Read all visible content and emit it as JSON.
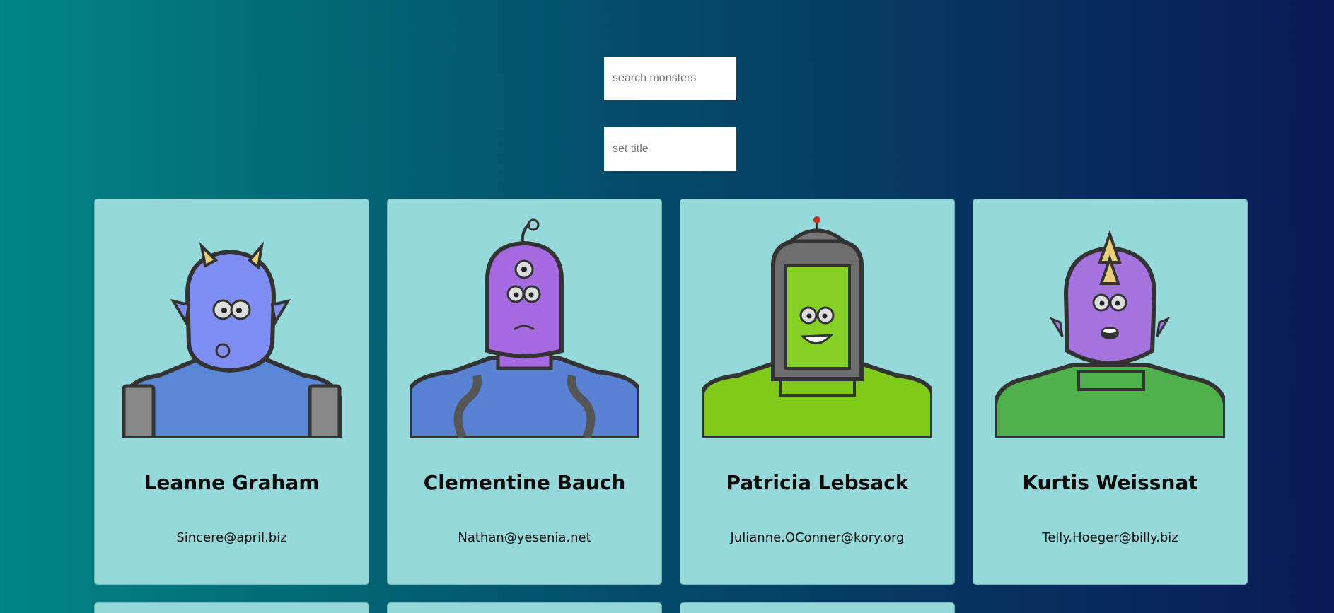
{
  "search": {
    "placeholder": "search monsters",
    "value": ""
  },
  "title_field": {
    "placeholder": "set title",
    "value": ""
  },
  "colors": {
    "card_bg": "#95d9da",
    "bg_left": "#028585",
    "bg_right": "#0a1a56"
  },
  "monsters": [
    {
      "name": "Leanne Graham",
      "email": "Sincere@april.biz",
      "icon": "blue-horned-monster-icon"
    },
    {
      "name": "Clementine Bauch",
      "email": "Nathan@yesenia.net",
      "icon": "purple-cyclops-robot-monster-icon"
    },
    {
      "name": "Patricia Lebsack",
      "email": "Julianne.OConner@kory.org",
      "icon": "green-helmet-monster-icon"
    },
    {
      "name": "Kurtis Weissnat",
      "email": "Telly.Hoeger@billy.biz",
      "icon": "purple-spiked-monster-icon"
    }
  ]
}
